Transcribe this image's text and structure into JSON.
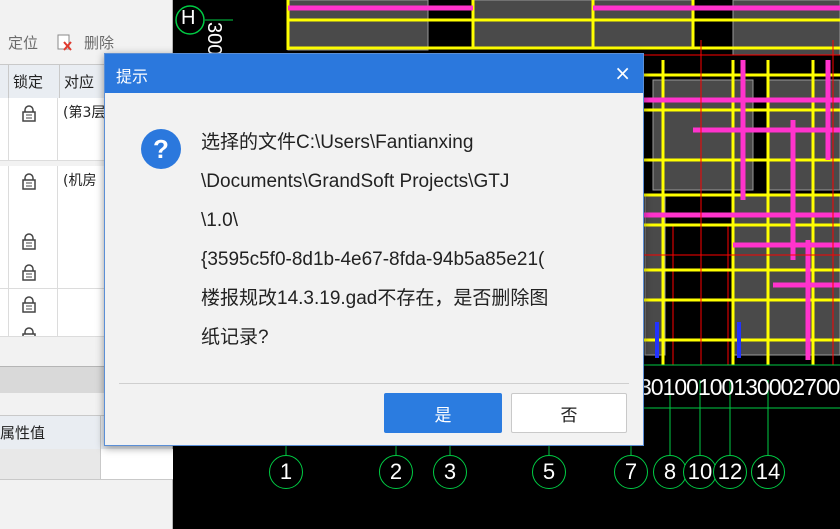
{
  "toolbar": {
    "locate_label": "定位",
    "delete_label": "删除"
  },
  "grid": {
    "headers": [
      "锁定",
      "对应"
    ],
    "rows": [
      {
        "lock": true,
        "text": "(第3层"
      },
      {
        "lock": false,
        "text": ""
      },
      {
        "lock": true,
        "text": "(机房"
      },
      {
        "lock": false,
        "text": ""
      },
      {
        "lock": true,
        "text": ""
      },
      {
        "lock": true,
        "text": ""
      },
      {
        "lock": true,
        "text": ""
      },
      {
        "lock": true,
        "text": ""
      }
    ]
  },
  "props": {
    "header_value": "属性值"
  },
  "cad": {
    "axis_letter": "H",
    "axis_number_partial": "300",
    "dimension_text": "30100100130002700",
    "axis_bubbles": [
      "1",
      "2",
      "3",
      "5",
      "7",
      "8",
      "10",
      "12",
      "14"
    ]
  },
  "dialog": {
    "title": "提示",
    "close_glyph": "×",
    "icon_glyph": "?",
    "message_lines": [
      "选择的文件C:\\Users\\Fantianxing",
      "\\Documents\\GrandSoft Projects\\GTJ",
      "\\1.0\\",
      "{3595c5f0-8d1b-4e67-8fda-94b5a85e21(",
      "楼报规改14.3.19.gad不存在，是否删除图",
      "纸记录?"
    ],
    "yes_label": "是",
    "no_label": "否"
  },
  "colors": {
    "accent": "#2b78dd",
    "cad_yellow": "#ffff00",
    "cad_magenta": "#ff33cc",
    "cad_green": "#00ff00",
    "cad_red": "#ff0000"
  }
}
